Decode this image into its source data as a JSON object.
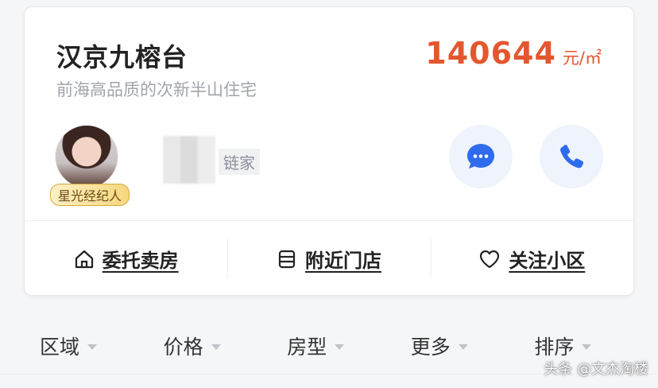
{
  "listing": {
    "title": "汉京九榕台",
    "subtitle": "前海高品质的次新半山住宅",
    "price_value": "140644",
    "price_unit": "元/㎡"
  },
  "agent": {
    "badge": "星光经纪人",
    "company": "链家"
  },
  "actions": [
    {
      "label": "委托卖房",
      "icon": "house-icon"
    },
    {
      "label": "附近门店",
      "icon": "store-icon"
    },
    {
      "label": "关注小区",
      "icon": "heart-icon"
    }
  ],
  "filters": [
    {
      "label": "区域"
    },
    {
      "label": "价格"
    },
    {
      "label": "房型"
    },
    {
      "label": "更多"
    },
    {
      "label": "排序"
    }
  ],
  "watermark": "头条 @文杰淘楼",
  "colors": {
    "price": "#e4572e",
    "accent_blue": "#2f6bed",
    "circle_bg": "#eef3fc"
  }
}
